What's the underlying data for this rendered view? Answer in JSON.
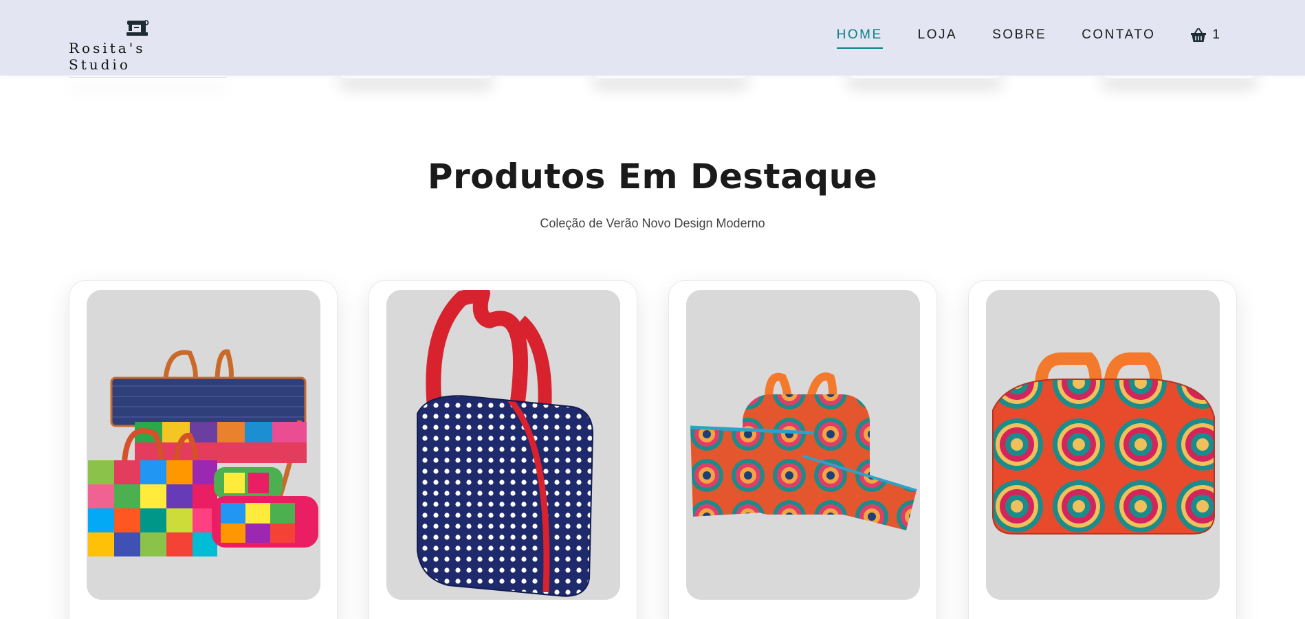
{
  "brand": {
    "name": "Rosita's Studio",
    "icon": "sewing-machine-icon"
  },
  "nav": {
    "items": [
      {
        "label": "HOME",
        "active": true
      },
      {
        "label": "LOJA",
        "active": false
      },
      {
        "label": "SOBRE",
        "active": false
      },
      {
        "label": "CONTATO",
        "active": false
      }
    ],
    "cart": {
      "icon": "basket-icon",
      "count": "1"
    }
  },
  "section": {
    "title": "Produtos Em Destaque",
    "subtitle": "Coleção de Verão Novo Design Moderno"
  },
  "products": [
    {
      "image": "patchwork-bag-set-image"
    },
    {
      "image": "polka-dot-travel-bag-image"
    },
    {
      "image": "mandala-pouch-set-image"
    },
    {
      "image": "mandala-travel-bag-image"
    }
  ],
  "colors": {
    "header_bg": "#e3e6f2",
    "accent": "#0a7f86",
    "image_bg": "#d9d9d9"
  }
}
